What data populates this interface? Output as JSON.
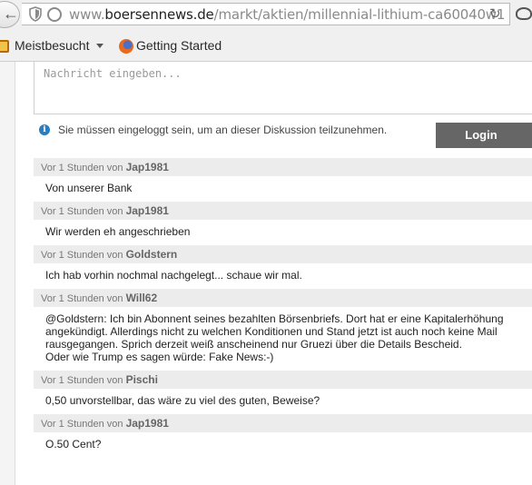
{
  "browser": {
    "url_prefix": "www.",
    "url_domain": "boersennews.de",
    "url_path": "/markt/aktien/millennial-lithium-ca60040w1",
    "back_icon": "←",
    "reload_icon": "↻"
  },
  "bookmarks": {
    "items": [
      {
        "label": "Meistbesucht",
        "icon": "folder-icon"
      },
      {
        "label": "Getting Started",
        "icon": "firefox-icon"
      }
    ]
  },
  "discussion": {
    "input_placeholder": "Nachricht eingeben...",
    "info_text": "Sie müssen eingeloggt sein, um an dieser Diskussion teilzunehmen.",
    "login_label": "Login",
    "comments": [
      {
        "time_prefix": "Vor 1 Stunden von",
        "author": "Jap1981",
        "lines": [
          "Von unserer Bank"
        ]
      },
      {
        "time_prefix": "Vor 1 Stunden von",
        "author": "Jap1981",
        "lines": [
          "Wir werden eh angeschrieben"
        ]
      },
      {
        "time_prefix": "Vor 1 Stunden von",
        "author": "Goldstern",
        "lines": [
          "Ich hab vorhin nochmal nachgelegt... schaue wir mal."
        ]
      },
      {
        "time_prefix": "Vor 1 Stunden von",
        "author": "Will62",
        "lines": [
          "@Goldstern: Ich bin Abonnent seines bezahlten Börsenbriefs. Dort hat er eine Kapitalerhöhung",
          "angekündigt. Allerdings nicht zu welchen Konditionen und Stand jetzt ist auch noch keine Mail",
          "rausgegangen. Sprich derzeit weiß anscheinend nur Gruezi über die Details Bescheid.",
          "Oder wie Trump es sagen würde: Fake News:-)"
        ]
      },
      {
        "time_prefix": "Vor 1 Stunden von",
        "author": "Pischi",
        "lines": [
          "0,50 unvorstellbar, das wäre zu viel des guten, Beweise?"
        ]
      },
      {
        "time_prefix": "Vor 1 Stunden von",
        "author": "Jap1981",
        "lines": [
          "O.50 Cent?"
        ]
      }
    ]
  }
}
